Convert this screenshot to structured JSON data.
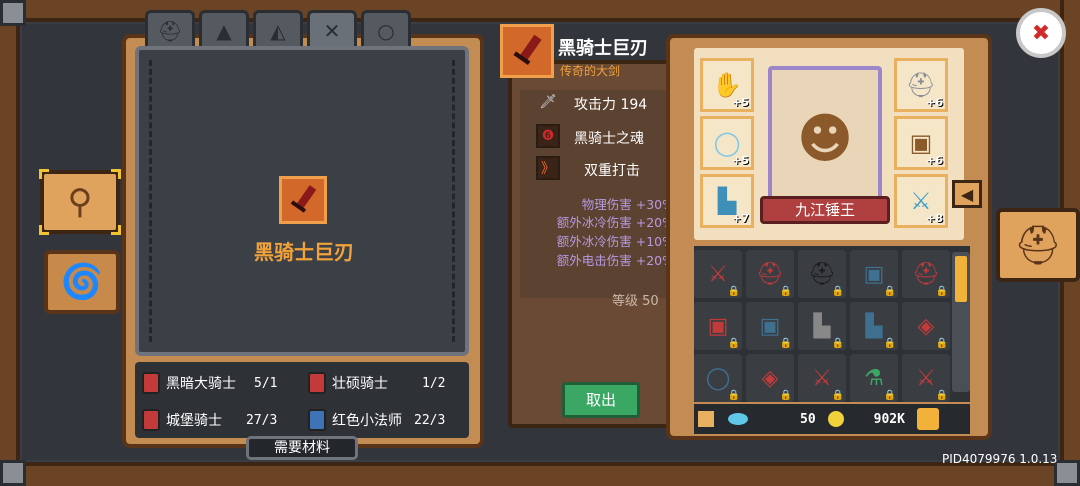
{
  "colors": {
    "accent_gold": "#f2a23a",
    "bonus_purple": "#b59ae0",
    "confirm_green": "#3aa864",
    "wood": "#c38c52"
  },
  "left_tabs": [
    "helmet-icon",
    "hat-icon",
    "wizard-hat-icon",
    "sword-icon",
    "ring-icon"
  ],
  "preview": {
    "item_name": "黑骑士巨刃",
    "item_icon": "greatsword-icon"
  },
  "materials": [
    {
      "name": "黑暗大骑士",
      "count": "5/1",
      "color": "#c23a3a"
    },
    {
      "name": "壮硕骑士",
      "count": "1/2",
      "color": "#c23a3a"
    },
    {
      "name": "城堡骑士",
      "count": "27/3",
      "color": "#c23a3a"
    },
    {
      "name": "红色小法师",
      "count": "22/3",
      "color": "#3f73b8"
    }
  ],
  "need_materials_label": "需要材料",
  "tooltip": {
    "title": "黑骑士巨刃",
    "subtitle": "传奇的大剑",
    "attack_label": "攻击力 194",
    "skills": [
      "黑骑士之魂",
      "双重打击"
    ],
    "bonuses": [
      "物理伤害 +30%",
      "额外冰冷伤害 +20%",
      "额外冰冷伤害 +10%",
      "额外电击伤害 +20%"
    ],
    "level_label": "等级 50",
    "cancel_label": "取出"
  },
  "equipment": {
    "hero_name": "九江锤王",
    "slots": [
      {
        "icon": "gloves-icon",
        "level": "+5"
      },
      {
        "icon": "helmet-icon",
        "level": "+6"
      },
      {
        "icon": "ring-icon",
        "level": "+5"
      },
      {
        "icon": "armor-icon",
        "level": "+6"
      },
      {
        "icon": "boots-icon",
        "level": "+7"
      },
      {
        "icon": "sword-icon",
        "level": "+8"
      }
    ]
  },
  "inventory": [
    {
      "icon": "sword-icon",
      "color": "#c23a3a"
    },
    {
      "icon": "helmet-icon",
      "color": "#c23a3a"
    },
    {
      "icon": "helmet-icon",
      "color": "#1a1a1a"
    },
    {
      "icon": "armor-icon",
      "color": "#3f7090"
    },
    {
      "icon": "helmet-icon",
      "color": "#c23a3a"
    },
    {
      "icon": "armor-icon",
      "color": "#c23a3a"
    },
    {
      "icon": "armor-icon",
      "color": "#3f7090"
    },
    {
      "icon": "boots-icon",
      "color": "#888888"
    },
    {
      "icon": "boots-icon",
      "color": "#3f7090"
    },
    {
      "icon": "amulet-icon",
      "color": "#c23a3a"
    },
    {
      "icon": "ring-icon",
      "color": "#3f7090"
    },
    {
      "icon": "amulet-icon",
      "color": "#c23a3a"
    },
    {
      "icon": "sword-icon",
      "color": "#c23a3a"
    },
    {
      "icon": "potion-icon",
      "color": "#3aa864"
    },
    {
      "icon": "sword-icon",
      "color": "#c23a3a"
    }
  ],
  "currency": {
    "gems": "50",
    "gold": "902K"
  },
  "version": "PID4079976 1.0.13"
}
